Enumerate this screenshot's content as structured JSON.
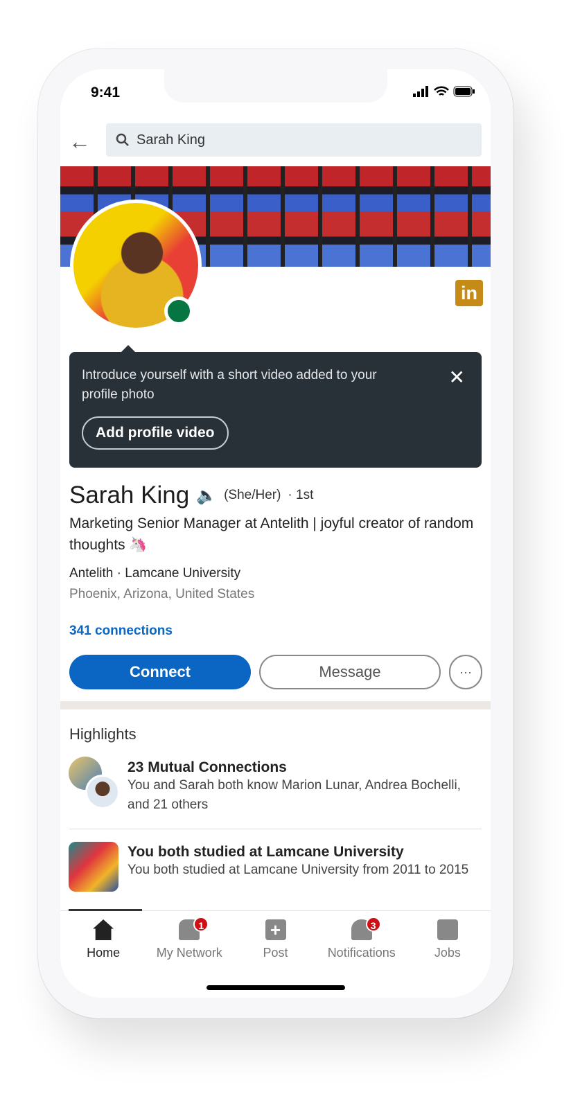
{
  "status_bar": {
    "time": "9:41"
  },
  "search": {
    "value": "Sarah King"
  },
  "tooltip": {
    "text": "Introduce yourself with a short video added to your profile photo",
    "button": "Add profile video"
  },
  "profile": {
    "name": "Sarah King",
    "pronouns": "(She/Her)",
    "degree": "· 1st",
    "headline": "Marketing Senior Manager at Antelith | joyful creator of random thoughts 🦄",
    "company": "Antelith",
    "school": "Lamcane University",
    "location": "Phoenix, Arizona, United States",
    "connections": "341 connections"
  },
  "actions": {
    "connect": "Connect",
    "message": "Message",
    "more": "···"
  },
  "highlights": {
    "title": "Highlights",
    "items": [
      {
        "title": "23 Mutual Connections",
        "subtitle": "You and Sarah both know Marion Lunar, Andrea Bochelli, and 21 others"
      },
      {
        "title": "You both studied at Lamcane University",
        "subtitle": "You both studied at Lamcane University from 2011 to 2015"
      }
    ]
  },
  "nav": [
    {
      "label": "Home",
      "icon": "home-icon"
    },
    {
      "label": "My Network",
      "icon": "network-icon",
      "badge": "1"
    },
    {
      "label": "Post",
      "icon": "plus-icon"
    },
    {
      "label": "Notifications",
      "icon": "bell-icon",
      "badge": "3"
    },
    {
      "label": "Jobs",
      "icon": "briefcase-icon"
    }
  ],
  "colors": {
    "brand": "#0a66c2",
    "tooltip_bg": "#293138",
    "online": "#057642",
    "badge": "#cc1016"
  }
}
